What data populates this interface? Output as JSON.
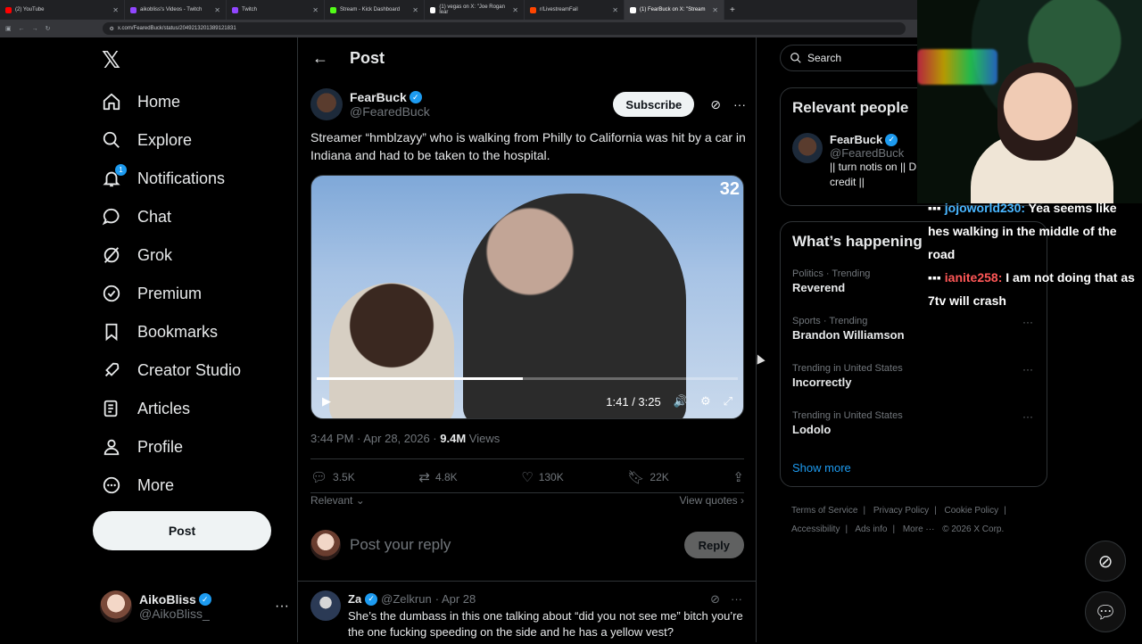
{
  "browser": {
    "tabs": [
      {
        "label": "(2) YouTube",
        "color": "#ff0000"
      },
      {
        "label": "aikobliss's Videos - Twitch",
        "color": "#9146ff"
      },
      {
        "label": "Twitch",
        "color": "#9146ff"
      },
      {
        "label": "Stream - Kick Dashboard",
        "color": "#53fc18"
      },
      {
        "label": "(1) vegas on X: \"Joe Rogan lear",
        "color": "#ffffff"
      },
      {
        "label": "r/LivestreamFail",
        "color": "#ff4500"
      },
      {
        "label": "(1) FearBuck on X: \"Stream",
        "color": "#ffffff"
      }
    ],
    "new_tab": "+",
    "url": "x.com/FearedBuck/status/2049213201389121831"
  },
  "nav": {
    "items": [
      {
        "label": "Home",
        "icon": "home-icon"
      },
      {
        "label": "Explore",
        "icon": "search-icon"
      },
      {
        "label": "Notifications",
        "icon": "bell-icon",
        "badge": "1"
      },
      {
        "label": "Chat",
        "icon": "chat-icon"
      },
      {
        "label": "Grok",
        "icon": "grok-icon"
      },
      {
        "label": "Premium",
        "icon": "premium-icon"
      },
      {
        "label": "Bookmarks",
        "icon": "bookmark-icon"
      },
      {
        "label": "Creator Studio",
        "icon": "rocket-icon"
      },
      {
        "label": "Articles",
        "icon": "article-icon"
      },
      {
        "label": "Profile",
        "icon": "person-icon"
      },
      {
        "label": "More",
        "icon": "more-icon"
      }
    ],
    "post_label": "Post",
    "account": {
      "name": "AikoBliss",
      "handle": "@AikoBliss_"
    }
  },
  "main": {
    "title": "Post",
    "tweet": {
      "name": "FearBuck",
      "handle": "@FearedBuck",
      "subscribe_label": "Subscribe",
      "text": "Streamer “hmblzayy” who is walking from Philly to California was hit by a car in Indiana and had to be taken to the hospital.",
      "video": {
        "counter": "32",
        "time": "1:41 / 3:25",
        "progress": 0.49
      },
      "time": "3:44 PM · Apr 28, 2026 ·",
      "views": "9.4M",
      "views_label": "Views",
      "replies": "3.5K",
      "reposts": "4.8K",
      "likes": "130K",
      "bookmarks": "22K"
    },
    "sort_label": "Relevant",
    "view_quotes": "View quotes",
    "reply_placeholder": "Post your reply",
    "reply_button": "Reply",
    "reply": {
      "name": "Za",
      "handle": "@Zelkrun",
      "date": "· Apr 28",
      "text": "She’s the dumbass in this one talking about “did you not see me” bitch you’re the one fucking speeding on the side and he has a yellow vest?"
    }
  },
  "right": {
    "search_placeholder": "Search",
    "relevant": {
      "title": "Relevant people",
      "name": "FearBuck",
      "handle": "@FearedBuck",
      "bio": "|| turn notis on || D credit ||"
    },
    "happening": {
      "title": "What’s happening",
      "trends": [
        {
          "category": "Politics · Trending",
          "title": "Reverend"
        },
        {
          "category": "Sports · Trending",
          "title": "Brandon Williamson"
        },
        {
          "category": "Trending in United States",
          "title": "Incorrectly"
        },
        {
          "category": "Trending in United States",
          "title": "Lodolo"
        }
      ],
      "show_more": "Show more"
    },
    "footer": [
      "Terms of Service",
      "|",
      "Privacy Policy",
      "|",
      "Cookie Policy",
      "|",
      "Accessibility",
      "|",
      "Ads info",
      "|",
      "More ···",
      "© 2026 X Corp."
    ]
  },
  "stream_chat": [
    {
      "user": "jojoworld230:",
      "message": "Yea seems like hes walking in the middle of the road"
    },
    {
      "user": "ianite258:",
      "message": "I am not doing that as 7tv will crash"
    }
  ],
  "colors": {
    "accent": "#1d9bf0",
    "background": "#000000"
  }
}
